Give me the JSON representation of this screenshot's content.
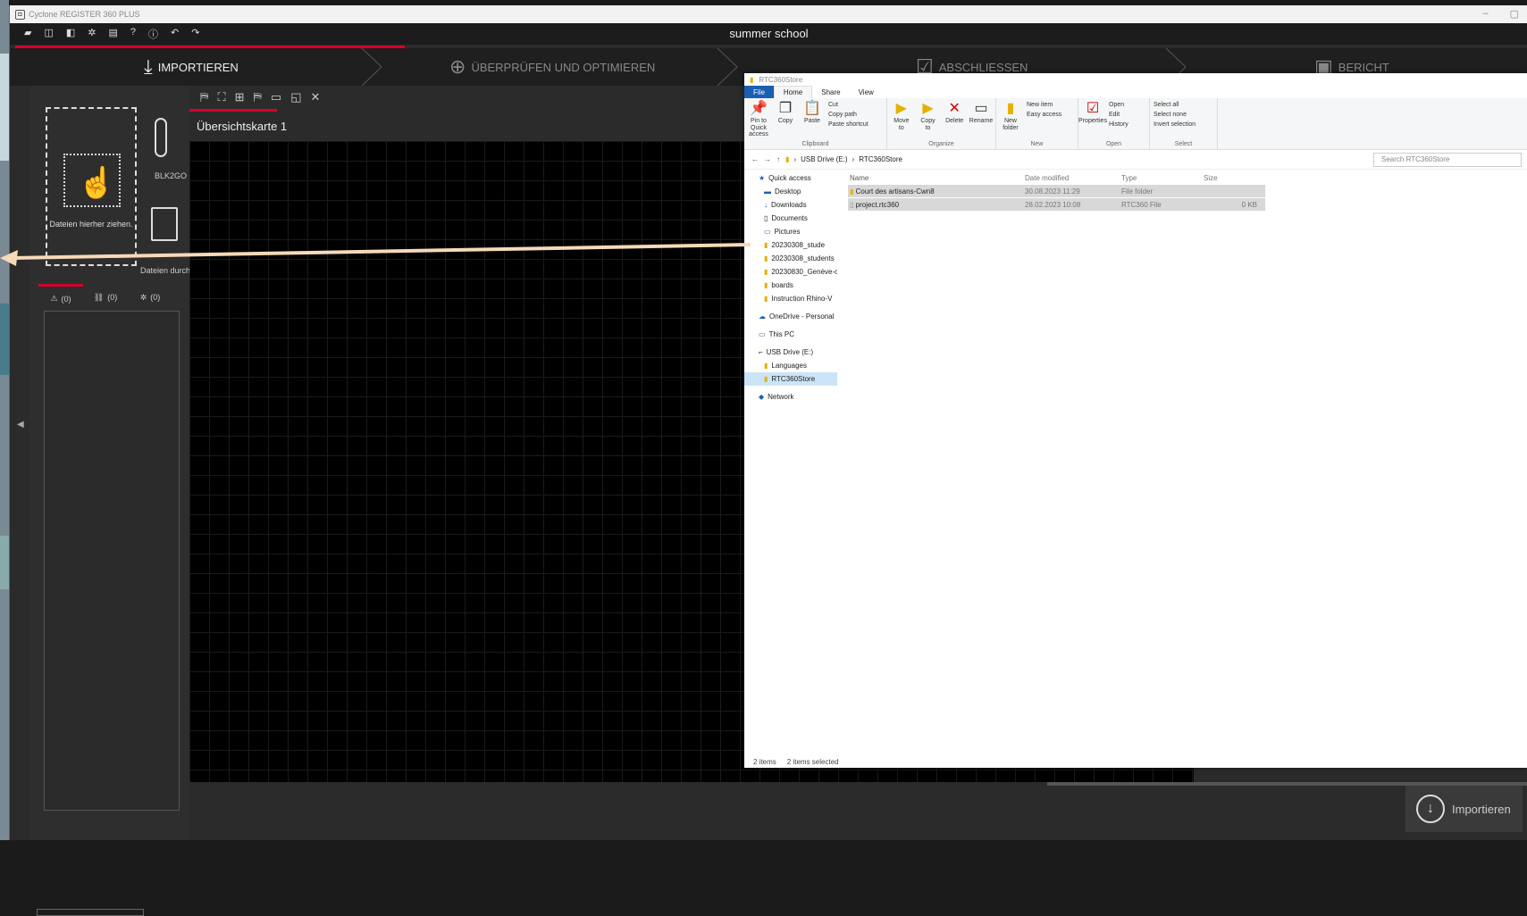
{
  "app": {
    "title": "Cyclone REGISTER 360 PLUS",
    "project": "summer school",
    "min": "–",
    "max": "▢"
  },
  "menu_icons": [
    "▰",
    "◫",
    "◧",
    "✲",
    "▤",
    "?",
    "ⓘ",
    "↶",
    "↷"
  ],
  "steps": {
    "import": "IMPORTIEREN",
    "review": "ÜBERPRÜFEN UND OPTIMIEREN",
    "finish": "ABSCHLIESSEN",
    "report": "BERICHT"
  },
  "left": {
    "drop_label": "Dateien hierher ziehen.",
    "usb_label": "BLK2GO",
    "browse_label": "Dateien durchsuchen",
    "tab_warnings": "(0)",
    "tab_links": "(0)",
    "tab_setups": "(0)"
  },
  "map": {
    "title": "Übersichtskarte 1",
    "tools": [
      "⛿",
      "⛶",
      "⊞",
      "⛿",
      "▭",
      "◱",
      "✕"
    ]
  },
  "import_button": "Importieren",
  "explorer": {
    "title": "RTC360Store",
    "tabs": {
      "file": "File",
      "home": "Home",
      "share": "Share",
      "view": "View"
    },
    "ribbon": {
      "clipboard": {
        "pin": "Pin to Quick access",
        "copy": "Copy",
        "paste": "Paste",
        "cut": "Cut",
        "copy_path": "Copy path",
        "paste_shortcut": "Paste shortcut",
        "name": "Clipboard"
      },
      "organize": {
        "move": "Move to",
        "copy": "Copy to",
        "delete": "Delete",
        "rename": "Rename",
        "name": "Organize"
      },
      "new": {
        "folder": "New folder",
        "item": "New item",
        "easy": "Easy access",
        "name": "New"
      },
      "open": {
        "properties": "Properties",
        "open": "Open",
        "edit": "Edit",
        "history": "History",
        "name": "Open"
      },
      "select": {
        "all": "Select all",
        "none": "Select none",
        "invert": "Invert selection",
        "name": "Select"
      }
    },
    "address": {
      "drive": "USB Drive (E:)",
      "folder": "RTC360Store",
      "search": "Search RTC360Store"
    },
    "nav": [
      "Quick access",
      "Desktop",
      "Downloads",
      "Documents",
      "Pictures",
      "20230308_stude",
      "20230308_students",
      "20230830_Genève-c",
      "boards",
      "Instruction Rhino-V",
      "OneDrive - Personal",
      "This PC",
      "USB Drive (E:)",
      "Languages",
      "RTC360Store",
      "Network"
    ],
    "columns": {
      "name": "Name",
      "date": "Date modified",
      "type": "Type",
      "size": "Size"
    },
    "files": [
      {
        "name": "Court des artisans-Cwn8",
        "date": "30.08.2023 11:29",
        "type": "File folder",
        "size": ""
      },
      {
        "name": "project.rtc360",
        "date": "28.02.2023 10:08",
        "type": "RTC360 File",
        "size": "0 KB"
      }
    ],
    "status": {
      "items": "2 items",
      "selected": "2 items selected"
    }
  },
  "colors": {
    "accent": "#d5002e",
    "explorer_blue": "#1a5fb4"
  }
}
